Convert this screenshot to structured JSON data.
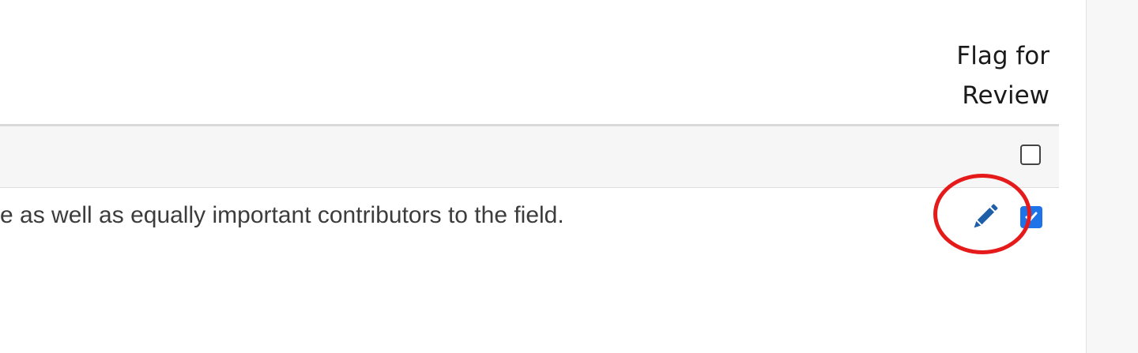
{
  "table": {
    "columns": {
      "flag_for_review": {
        "label_line1": "Flag for",
        "label_line2": "Review"
      }
    },
    "rows": [
      {
        "text": "",
        "flagged": false
      },
      {
        "text": "e as well as equally important contributors to the field.",
        "flagged": true,
        "edit_icon": "pencil-icon"
      }
    ]
  },
  "colors": {
    "accent": "#1e73e8",
    "highlight": "#e51b1b",
    "row_stripe": "#f6f6f6"
  }
}
